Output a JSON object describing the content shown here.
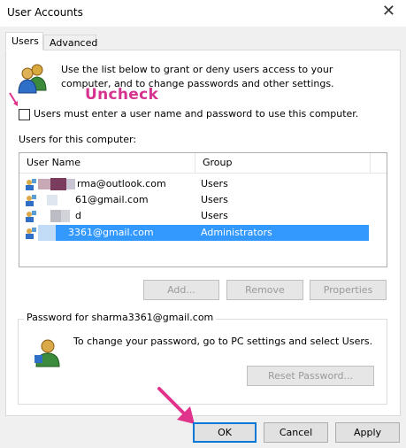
{
  "window": {
    "title": "User Accounts",
    "close_glyph": "✕"
  },
  "tabs": [
    {
      "label": "Users",
      "active": true
    },
    {
      "label": "Advanced",
      "active": false
    }
  ],
  "intro": {
    "text": "Use the list below to grant or deny users access to your computer, and to change passwords and other settings."
  },
  "annotation": {
    "text": "Uncheck",
    "color": "#d6338f"
  },
  "checkbox": {
    "label": "Users must enter a user name and password to use this computer.",
    "checked": false
  },
  "users_list": {
    "label": "Users for this computer:",
    "columns": [
      "User Name",
      "Group"
    ],
    "rows": [
      {
        "user": "rma@outlook.com",
        "group": "Users",
        "selected": false
      },
      {
        "user": "61@gmail.com",
        "group": "Users",
        "selected": false
      },
      {
        "user": "d",
        "group": "Users",
        "selected": false
      },
      {
        "user": "3361@gmail.com",
        "group": "Administrators",
        "selected": true
      }
    ]
  },
  "list_buttons": {
    "add": "Add...",
    "remove": "Remove",
    "properties": "Properties"
  },
  "password_group": {
    "label": "Password for sharma3361@gmail.com",
    "text": "To change your password, go to PC settings and select Users.",
    "reset_button": "Reset Password..."
  },
  "footer_buttons": {
    "ok": "OK",
    "cancel": "Cancel",
    "apply": "Apply"
  },
  "icons": {
    "users": "users-icon",
    "user": "user-icon",
    "arrow": "pink-arrow-icon"
  },
  "colors": {
    "selection": "#3399ff",
    "accent": "#0078d7",
    "annotation": "#d6338f"
  }
}
